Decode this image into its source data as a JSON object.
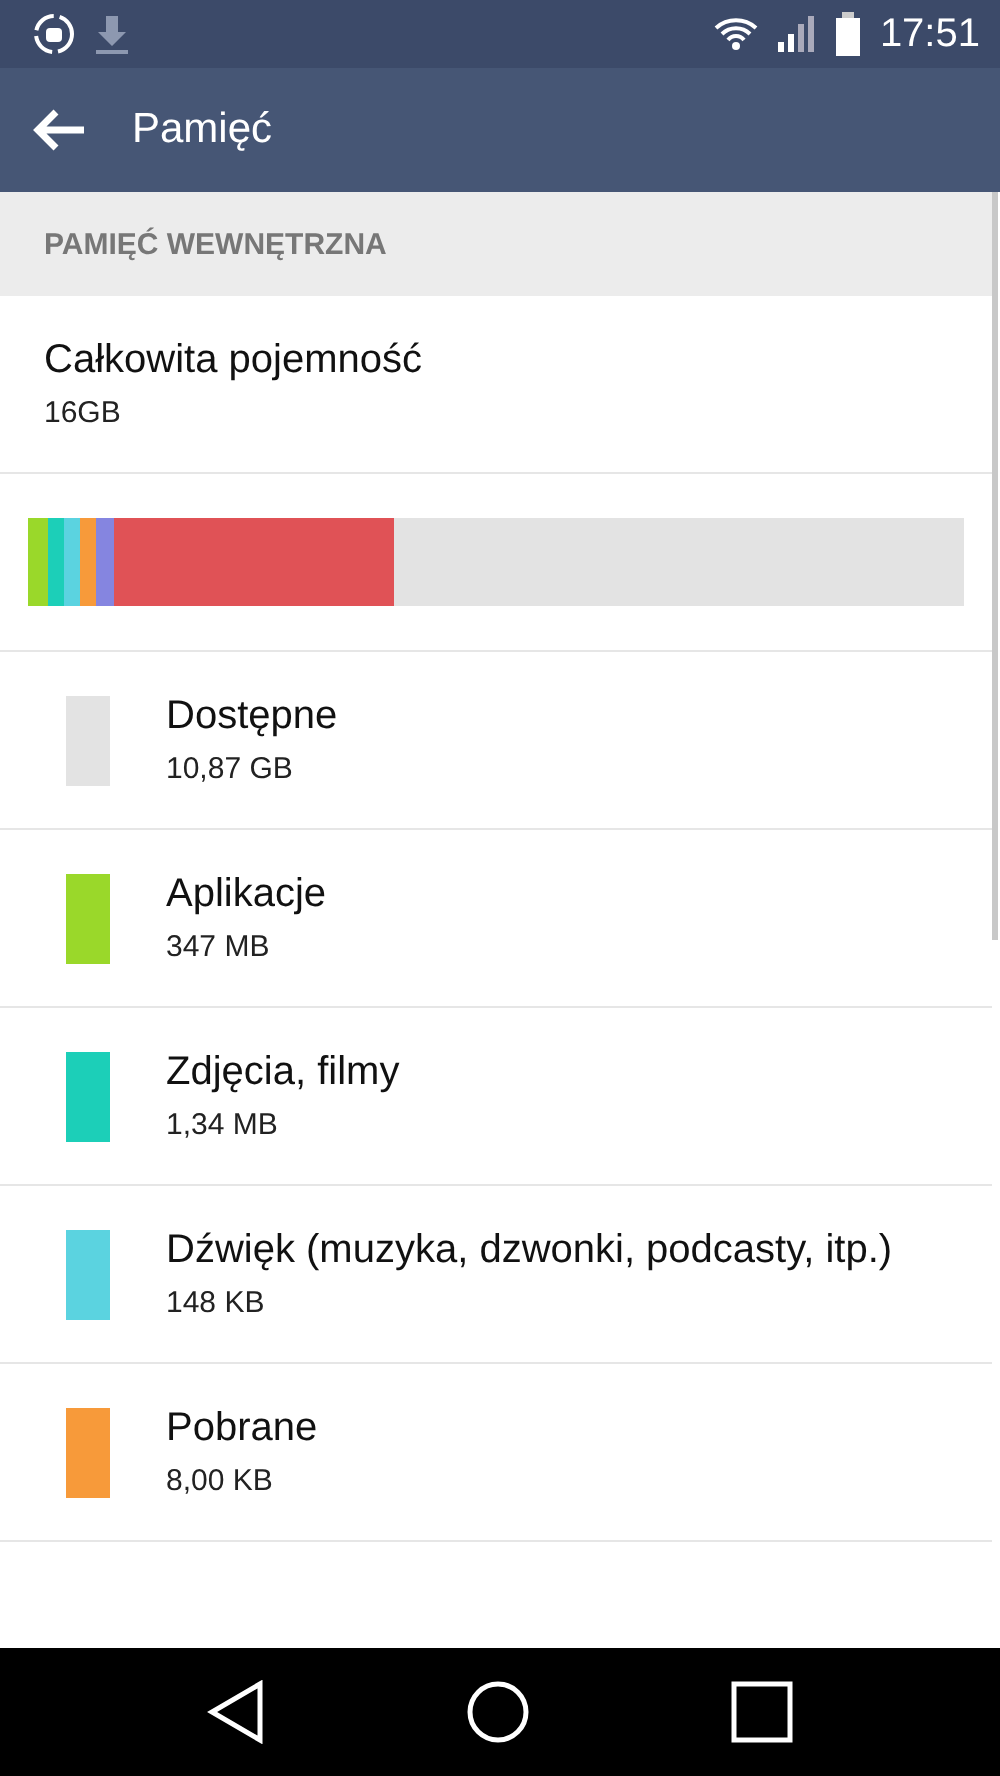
{
  "status_bar": {
    "time": "17:51"
  },
  "app_bar": {
    "title": "Pamięć"
  },
  "section": {
    "header": "PAMIĘĆ WEWNĘTRZNA"
  },
  "total": {
    "label": "Całkowita pojemność",
    "value": "16GB"
  },
  "usage_bar": {
    "segments": [
      {
        "color": "#9ad82a"
      },
      {
        "color": "#1ccfb8"
      },
      {
        "color": "#5bd3e0"
      },
      {
        "color": "#f79a3a"
      },
      {
        "color": "#8585e0"
      },
      {
        "color": "#e05256"
      }
    ]
  },
  "categories": [
    {
      "name": "Dostępne",
      "size": "10,87 GB",
      "color": "#e3e3e3"
    },
    {
      "name": "Aplikacje",
      "size": "347 MB",
      "color": "#9ad82a"
    },
    {
      "name": "Zdjęcia, filmy",
      "size": "1,34 MB",
      "color": "#1ccfb8"
    },
    {
      "name": "Dźwięk (muzyka, dzwonki, podcasty, itp.)",
      "size": "148 KB",
      "color": "#5bd3e0"
    },
    {
      "name": "Pobrane",
      "size": "8,00 KB",
      "color": "#f79a3a"
    }
  ]
}
